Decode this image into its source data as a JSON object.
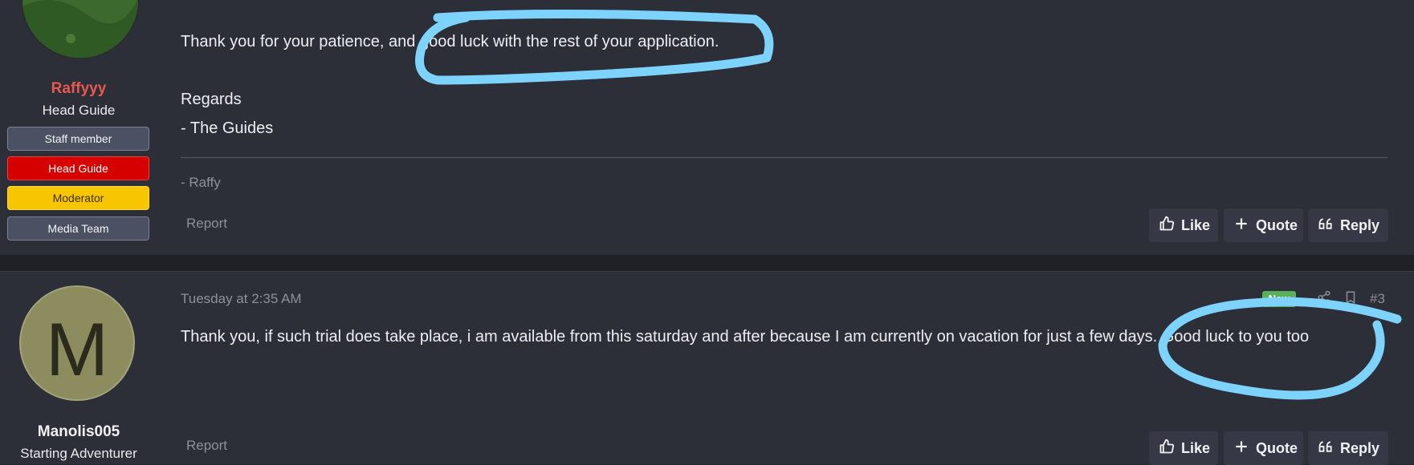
{
  "post1": {
    "username": "Raffyyy",
    "user_title": "Head Guide",
    "banners": [
      "Staff member",
      "Head Guide",
      "Moderator",
      "Media Team"
    ],
    "message_lines": [
      "Thank you for your patience, and good luck with the rest of your application.",
      "Regards",
      "- The Guides"
    ],
    "signature": "- Raffy",
    "report_label": "Report",
    "actions": {
      "like": "Like",
      "quote": "Quote",
      "reply": "Reply"
    }
  },
  "post2": {
    "avatar_letter": "M",
    "date": "Tuesday at 2:35 AM",
    "new_badge": "New",
    "post_number": "#3",
    "message": "Thank you, if such trial does take place, i am available from this saturday and after because I am currently on vacation for just a few days. Good luck to you too",
    "username": "Manolis005",
    "user_title": "Starting Adventurer",
    "report_label": "Report",
    "actions": {
      "like": "Like",
      "quote": "Quote",
      "reply": "Reply"
    }
  },
  "colors": {
    "background": "#2d2f38",
    "username_staff": "#e7584f",
    "head_guide_banner": "#d60000",
    "moderator_banner": "#f7c600",
    "staff_banner": "#4b5163",
    "annotation_stroke": "#7dd3fc",
    "new_badge": "#5ab05a"
  },
  "icons": {
    "like": "thumbs-up-icon",
    "quote": "plus-icon",
    "reply": "quote-marks-icon",
    "share": "share-icon",
    "bookmark": "bookmark-icon"
  }
}
